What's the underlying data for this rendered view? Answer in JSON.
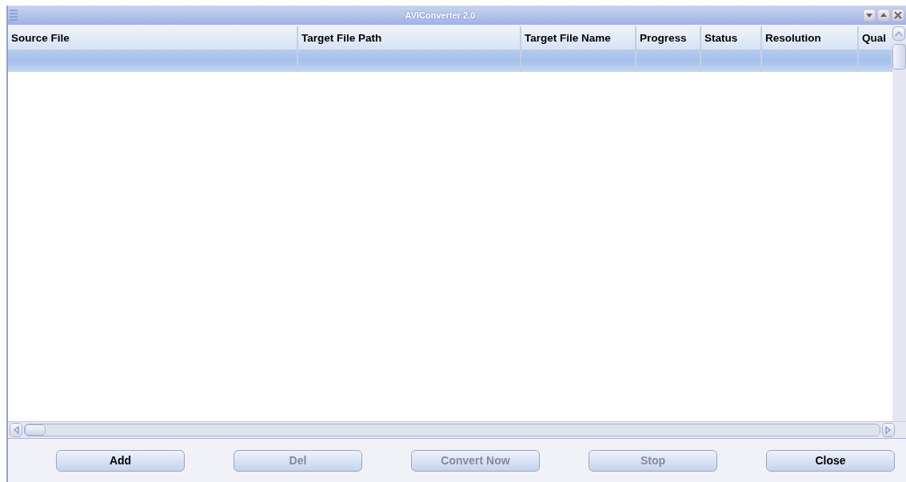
{
  "window": {
    "title": "AVIConverter 2.0"
  },
  "table": {
    "columns": [
      {
        "label": "Source File"
      },
      {
        "label": "Target File Path"
      },
      {
        "label": "Target File Name"
      },
      {
        "label": "Progress"
      },
      {
        "label": "Status"
      },
      {
        "label": "Resolution"
      },
      {
        "label": "Qual"
      }
    ],
    "rows": [
      {
        "selected": true
      }
    ]
  },
  "buttons": [
    {
      "label": "Add",
      "disabled": false
    },
    {
      "label": "Del",
      "disabled": true
    },
    {
      "label": "Convert Now",
      "disabled": true
    },
    {
      "label": "Stop",
      "disabled": true
    },
    {
      "label": "Close",
      "disabled": false
    }
  ]
}
